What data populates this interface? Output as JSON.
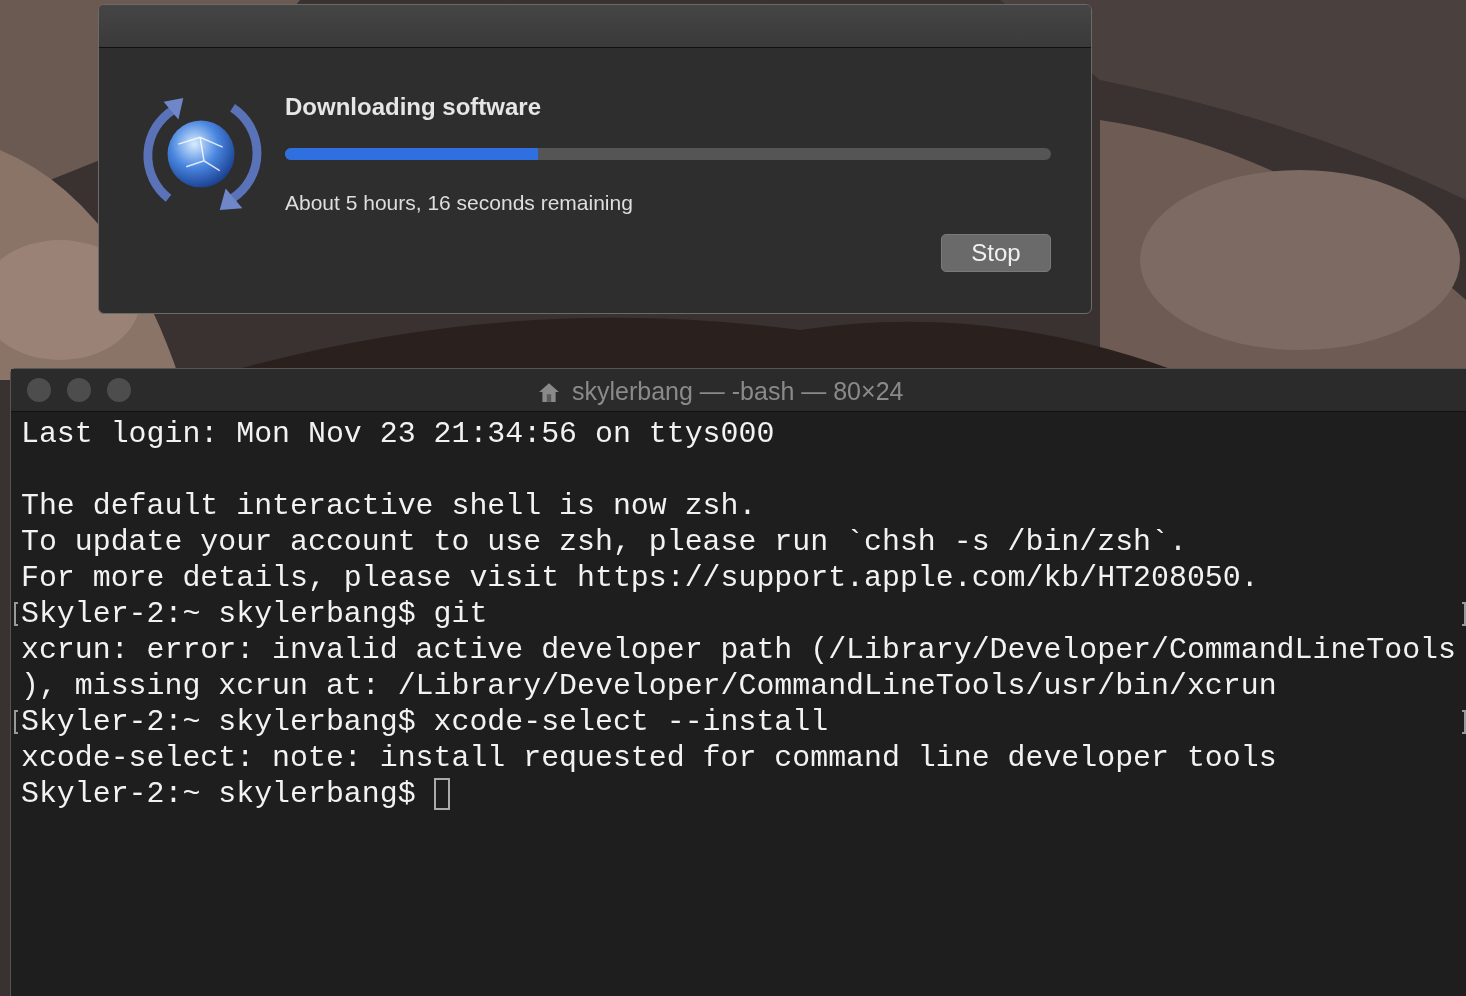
{
  "dialog": {
    "title": "Downloading software",
    "progress": {
      "level": 0.33
    },
    "status": "About 5 hours, 16 seconds remaining",
    "buttons": [
      {
        "label": "Stop"
      }
    ]
  },
  "terminal": {
    "title": "skylerbang — -bash — 80×24",
    "active": false,
    "lines": [
      {
        "kind": "output",
        "text": "Last login: Mon Nov 23 21:34:56 on ttys000"
      },
      {
        "kind": "blank"
      },
      {
        "kind": "output",
        "text": "The default interactive shell is now zsh."
      },
      {
        "kind": "output",
        "text": "To update your account to use zsh, please run `chsh -s /bin/zsh`."
      },
      {
        "kind": "output",
        "text": "For more details, please visit https://support.apple.com/kb/HT208050."
      },
      {
        "kind": "prompt",
        "text": "Skyler-2:~ skylerbang$ git",
        "marked": true
      },
      {
        "kind": "output",
        "text": "xcrun: error: invalid active developer path (/Library/Developer/CommandLineTools"
      },
      {
        "kind": "output",
        "text": "), missing xcrun at: /Library/Developer/CommandLineTools/usr/bin/xcrun"
      },
      {
        "kind": "prompt",
        "text": "Skyler-2:~ skylerbang$ xcode-select --install",
        "marked": true
      },
      {
        "kind": "output",
        "text": "xcode-select: note: install requested for command line developer tools"
      },
      {
        "kind": "prompt",
        "text": "Skyler-2:~ skylerbang$",
        "marked": false,
        "cursor": true
      }
    ]
  }
}
